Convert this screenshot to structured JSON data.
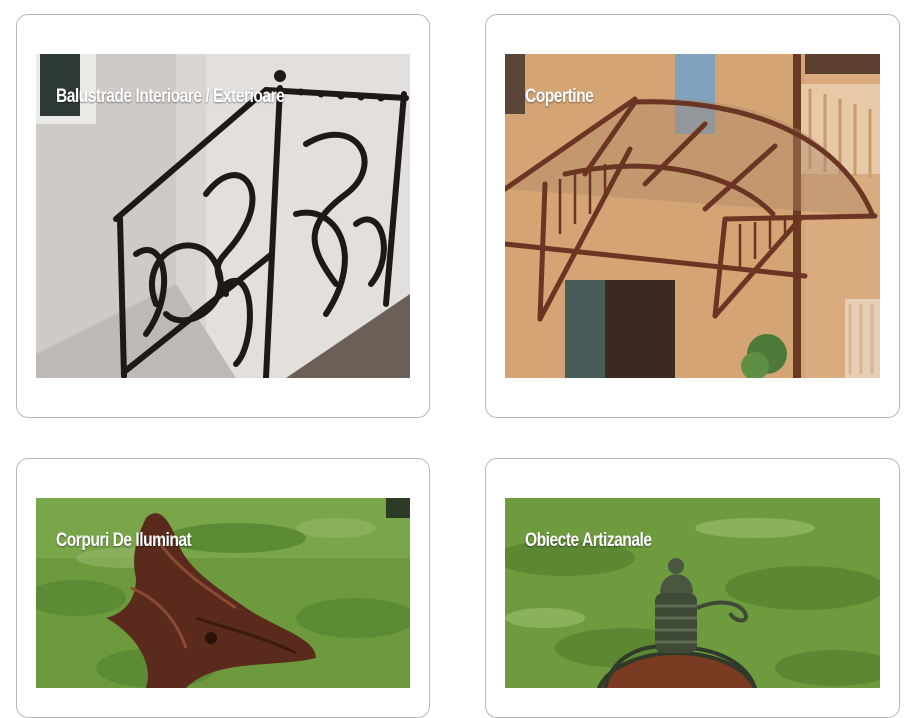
{
  "gallery": {
    "items": [
      {
        "title": "Balustrade Interioare / Exterioare"
      },
      {
        "title": "Copertine"
      },
      {
        "title": "Corpuri De Iluminat"
      },
      {
        "title": "Obiecte Artizanale"
      }
    ]
  }
}
